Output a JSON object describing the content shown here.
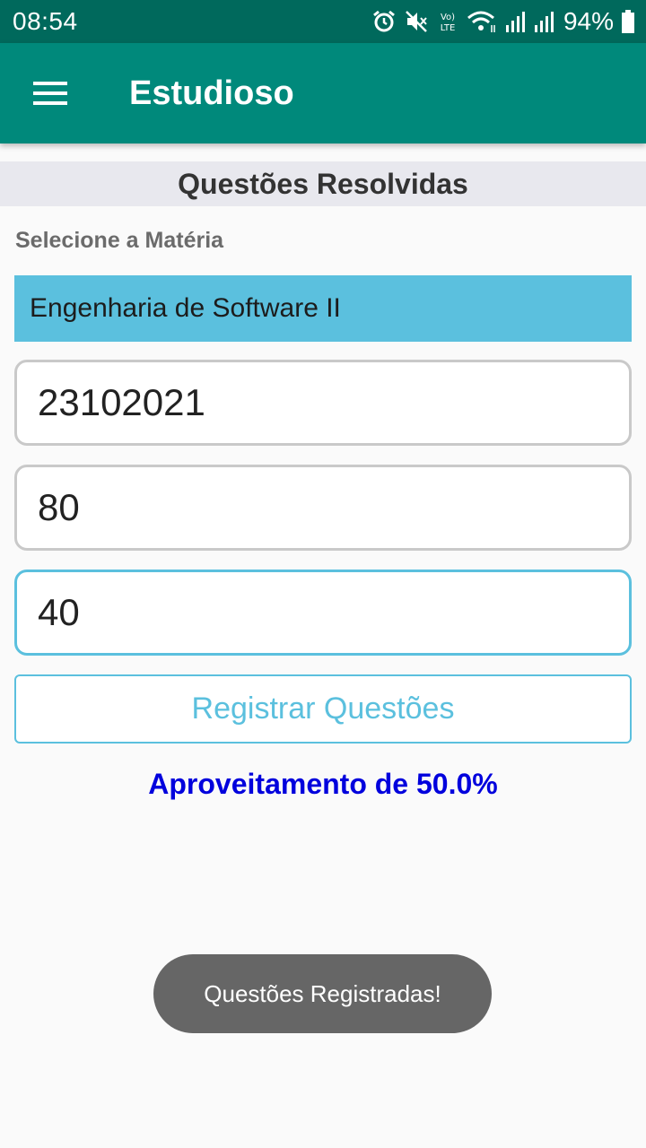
{
  "status_bar": {
    "time": "08:54",
    "battery": "94%",
    "icons": [
      "alarm-icon",
      "mute-icon",
      "volte-icon",
      "wifi-icon",
      "signal-icon",
      "signal-icon",
      "battery-icon"
    ]
  },
  "app_bar": {
    "title": "Estudioso",
    "menu_icon": "hamburger-menu-icon"
  },
  "section": {
    "title": "Questões Resolvidas"
  },
  "form": {
    "select_label": "Selecione a Matéria",
    "subject_selected": "Engenharia de Software II",
    "date_value": "23102021",
    "total_value": "80",
    "correct_value": "40",
    "register_label": "Registrar Questões"
  },
  "result": {
    "text": "Aproveitamento de 50.0%"
  },
  "toast": {
    "text": "Questões Registradas!"
  },
  "colors": {
    "status_bar": "#00695c",
    "app_bar": "#00897b",
    "accent": "#5bc0de",
    "result_text": "#0000dd",
    "toast": "#666666"
  }
}
